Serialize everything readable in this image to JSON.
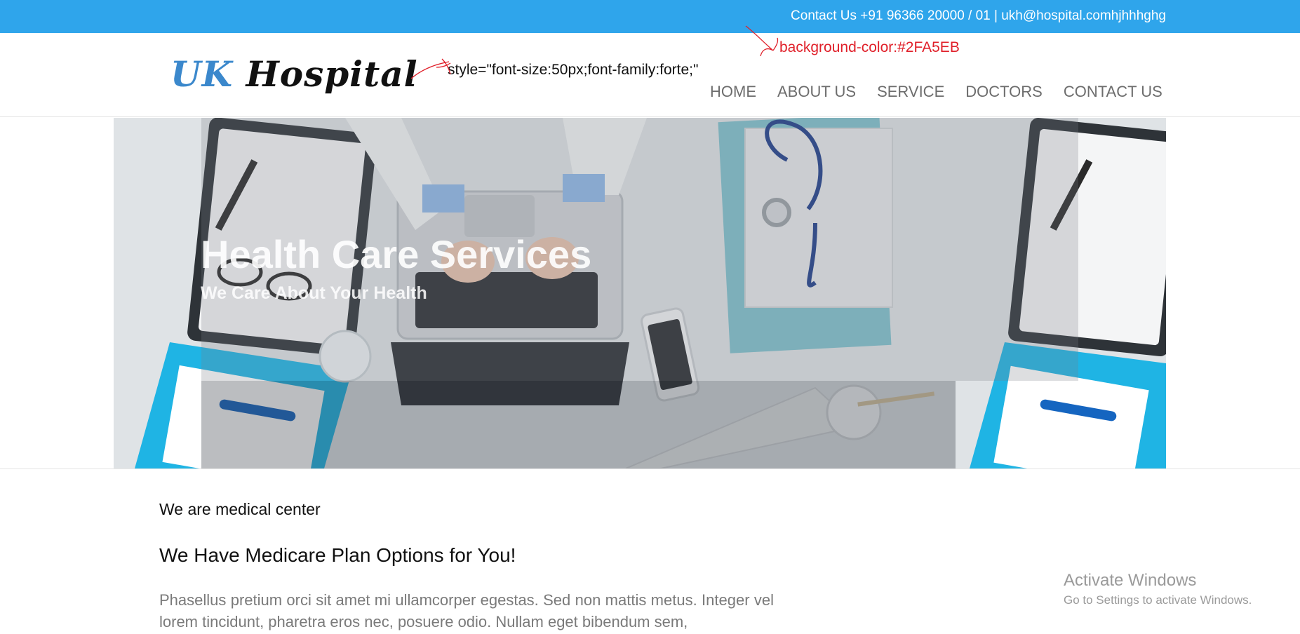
{
  "topbar": {
    "contact_text": "Contact Us +91 96366 20000 / 01 | ukh@hospital.comhjhhhghg",
    "background_color": "#2FA5EB"
  },
  "logo": {
    "part1": "UK",
    "part2": "Hospital",
    "part1_color": "#3B88CC",
    "part2_color": "#111111"
  },
  "annotations": {
    "style_note": "style=\"font-size:50px;font-family:forte;\"",
    "bg_note": "background-color:#2FA5EB",
    "bg_note_color": "#E0202A"
  },
  "nav": {
    "items": [
      {
        "label": "HOME"
      },
      {
        "label": "ABOUT US"
      },
      {
        "label": "SERVICE"
      },
      {
        "label": "DOCTORS"
      },
      {
        "label": "CONTACT US"
      }
    ]
  },
  "hero": {
    "title": "Health Care Services",
    "subtitle": "We Care About Your Health"
  },
  "section": {
    "label": "We are medical center",
    "heading": "We Have Medicare Plan Options for You!",
    "paragraph": "Phasellus pretium orci sit amet mi ullamcorper egestas. Sed non mattis metus. Integer vel lorem tincidunt, pharetra eros nec, posuere odio. Nullam eget bibendum sem,"
  },
  "watermark": {
    "title": "Activate Windows",
    "subtitle": "Go to Settings to activate Windows."
  }
}
